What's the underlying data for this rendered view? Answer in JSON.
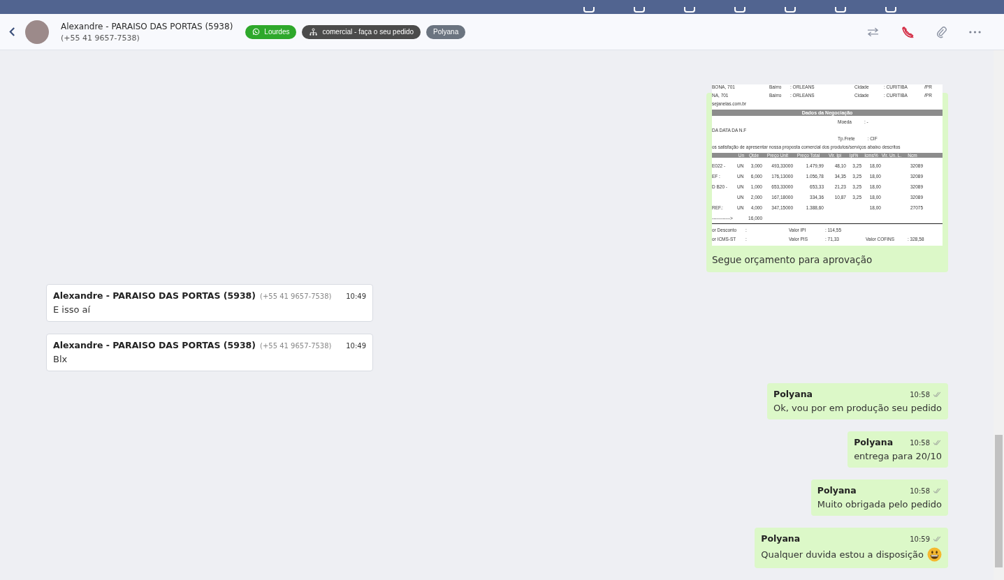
{
  "header": {
    "contact_name": "Alexandre - PARAISO DAS PORTAS (5938)",
    "contact_phone": "(+55 41 9657-7538)",
    "tags": [
      {
        "kind": "whatsapp",
        "label": "Lourdes",
        "color": "#2ea82b"
      },
      {
        "kind": "queue",
        "label": "comercial - faça o seu pedido",
        "color": "#4b4b4b"
      },
      {
        "kind": "plain",
        "label": "Polyana",
        "color": "#6b7480"
      }
    ]
  },
  "messages": [
    {
      "kind": "document",
      "outgoing": true,
      "caption": "Segue orçamento para aprovação",
      "document": {
        "address_lines": [
          [
            "BONA, 701",
            "Bairro",
            ": ORLEANS",
            "Cidade",
            ": CURITIBA",
            "/PR"
          ],
          [
            "NA, 701",
            "Bairro",
            ": ORLEANS",
            "Cidade",
            ": CURITIBA",
            "/PR"
          ]
        ],
        "website": "sejanelas.com.br",
        "section_title": "Dados da Negociação",
        "currency_label": "Moeda",
        "currency_value": ": -",
        "date_note": "DA DATA DA N.F",
        "freight_label": "Tp.Frete",
        "freight_value": ": CIF",
        "intro": "os satisfação de apresentar nossa proposta comercial dos produtos/serviços abaixo descritos",
        "columns": [
          null,
          "Un",
          "Qtde",
          "Preço Unit",
          "Preço Total",
          "Vlr. Ipi",
          "Ipi%",
          "Icms%",
          "Vlr. Un. L.",
          "Ncm"
        ],
        "rows": [
          [
            "E022 -",
            "UN",
            "3,000",
            "493,33000",
            "1.479,99",
            "48,10",
            "3,25",
            "18,00",
            null,
            "32089"
          ],
          [
            "EF :",
            "UN",
            "6,000",
            "176,13000",
            "1.056,78",
            "34,35",
            "3,25",
            "18,00",
            null,
            "32089"
          ],
          [
            "D B20 -",
            "UN",
            "1,000",
            "653,33000",
            "653,33",
            "21,23",
            "3,25",
            "18,00",
            null,
            "32089"
          ],
          [
            null,
            "UN",
            "2,000",
            "167,18000",
            "334,36",
            "10,87",
            "3,25",
            "18,00",
            null,
            "32089"
          ],
          [
            "REF.:",
            "UN",
            "4,000",
            "347,15000",
            "1.388,60",
            null,
            null,
            "18,00",
            null,
            "27075"
          ]
        ],
        "total_arrow": "------------>",
        "total_qty": "16,000",
        "footer_lines": [
          [
            "or Desconto",
            ":",
            "Valor IPI",
            ": 114,55"
          ],
          [
            "or ICMS-ST",
            ":",
            "Valor PIS",
            ": 71,33",
            "Valor COFINS",
            ": 328,58"
          ]
        ]
      }
    },
    {
      "kind": "text",
      "outgoing": false,
      "sender": "Alexandre - PARAISO DAS PORTAS (5938)",
      "phone": "(+55 41 9657-7538)",
      "time": "10:49",
      "text": "E isso aí"
    },
    {
      "kind": "text",
      "outgoing": false,
      "sender": "Alexandre - PARAISO DAS PORTAS (5938)",
      "phone": "(+55 41 9657-7538)",
      "time": "10:49",
      "text": "Blx"
    },
    {
      "kind": "text",
      "outgoing": true,
      "sender": "Polyana",
      "time": "10:58",
      "text": "Ok, vou por em produção seu pedido"
    },
    {
      "kind": "text",
      "outgoing": true,
      "sender": "Polyana",
      "time": "10:58",
      "text": "entrega para 20/10"
    },
    {
      "kind": "text",
      "outgoing": true,
      "sender": "Polyana",
      "time": "10:58",
      "text": "Muito obrigada pelo pedido"
    },
    {
      "kind": "emoji_text",
      "outgoing": true,
      "sender": "Polyana",
      "time": "10:59",
      "text": "Qualquer duvida estou a disposição"
    }
  ]
}
